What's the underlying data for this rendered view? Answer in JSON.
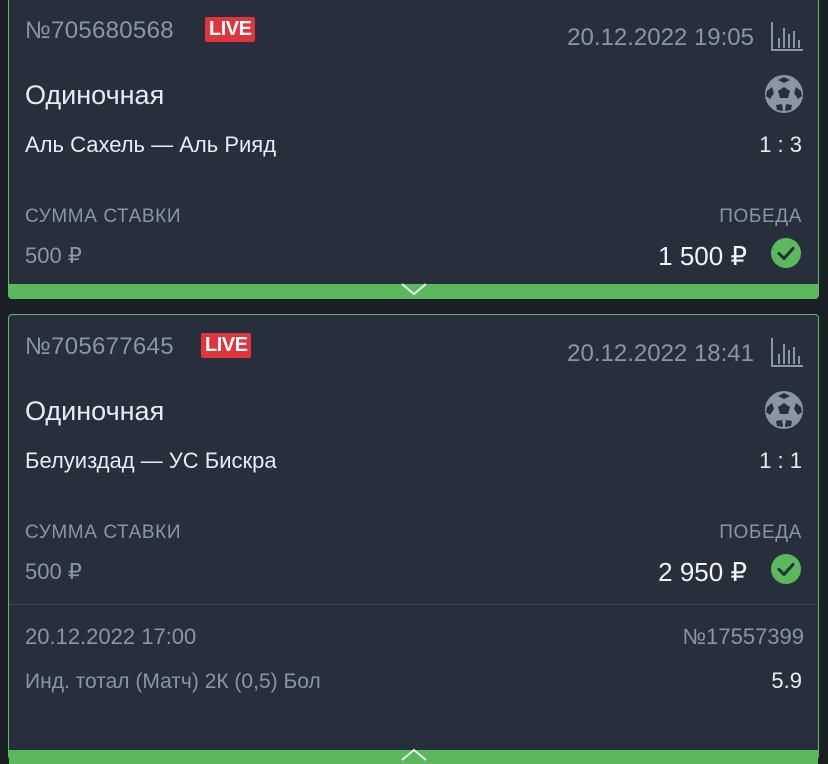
{
  "bets": [
    {
      "id": "№705680568",
      "live_badge": "LIVE",
      "datetime": "20.12.2022 19:05",
      "bet_type": "Одиночная",
      "sport_icon": "soccer-ball-icon",
      "match": "Аль Сахель — Аль Рияд",
      "score": "1 : 3",
      "stake_label": "СУММА СТАВКИ",
      "stake": "500 ₽",
      "result_label": "ПОБЕДА",
      "payout": "1 500 ₽",
      "expanded": false
    },
    {
      "id": "№705677645",
      "live_badge": "LIVE",
      "datetime": "20.12.2022 18:41",
      "bet_type": "Одиночная",
      "sport_icon": "soccer-ball-icon",
      "match": "Белуиздад — УС Бискра",
      "score": "1 : 1",
      "stake_label": "СУММА СТАВКИ",
      "stake": "500 ₽",
      "result_label": "ПОБЕДА",
      "payout": "2 950 ₽",
      "expanded": true,
      "event": {
        "datetime": "20.12.2022 17:00",
        "event_id": "№17557399",
        "market": "Инд. тотал (Матч) 2К (0,5) Бол",
        "odds": "5.9"
      }
    }
  ],
  "colors": {
    "background": "#1a1f26",
    "card": "#262f3b",
    "win_green": "#5cb85c",
    "live_red": "#e0353c",
    "muted_text": "#8b96a3",
    "primary_text": "#e8ecf0"
  }
}
